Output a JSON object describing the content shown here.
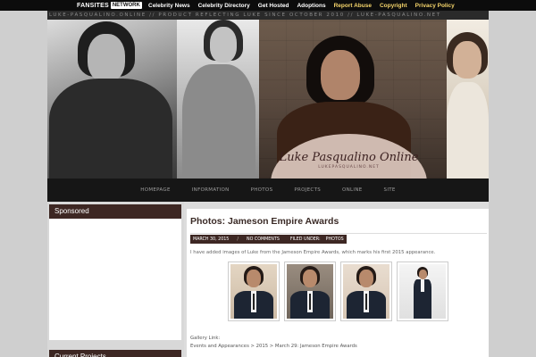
{
  "network": {
    "brand_main": "FANSITES",
    "brand_tag": "NETWORK",
    "links": [
      "Celebrity News",
      "Celebrity Directory",
      "Get Hosted",
      "Adoptions",
      "Report Abuse",
      "Copyright",
      "Privacy Policy"
    ],
    "highlight_color": "#f6d56b"
  },
  "site": {
    "top_strip": "LUKE-PASQUALINO.ONLINE // PRODUCT REFLECTING LUKE SINCE OCTOBER 2010 // LUKE-PASQUALINO.NET",
    "logo_title": "Luke Pasqualino Online",
    "logo_subtitle": "LUKEPASQUALINO.NET"
  },
  "nav": [
    "HOMEPAGE",
    "INFORMATION",
    "PHOTOS",
    "PROJECTS",
    "ONLINE",
    "SITE"
  ],
  "sidebar": {
    "widget1_title": "Sponsored",
    "widget2_title": "Current Projects"
  },
  "post": {
    "title": "Photos: Jameson Empire Awards",
    "date": "MARCH 30, 2015",
    "comments": "NO COMMENTS",
    "filed_label": "FILED UNDER:",
    "filed_value": "PHOTOS",
    "excerpt": "I have added images of Luke from the Jameson Empire Awards, which marks his first 2015 appearance.",
    "gallery_label": "Gallery Link:",
    "gallery_path": "Events and Appearances > 2015 > March 29: Jameson Empire Awards"
  },
  "colors": {
    "accent": "#3d2723",
    "nav_bg": "#161616"
  }
}
